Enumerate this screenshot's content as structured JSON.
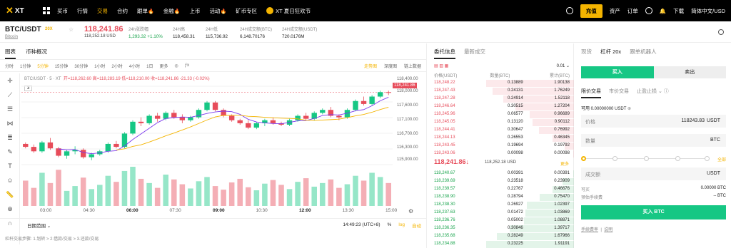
{
  "topbar": {
    "logo": "XT",
    "nav": [
      "买币",
      "行情",
      "交易",
      "合约",
      "跟单",
      "金融",
      "上币",
      "活动",
      "矿币专区"
    ],
    "active_nav": "交易",
    "banner": "XT 夏日狂欢节",
    "recharge": "充值",
    "assets": "资产",
    "orders": "订单",
    "download": "下载",
    "lang": "简体中文/USD"
  },
  "ticker": {
    "pair": "BTC/USDT",
    "leverage": "20X",
    "name": "Bitcoin",
    "price": "118,241.86",
    "price_usd": "118,252.18 USD",
    "stats": [
      {
        "label": "24h涨跌幅",
        "value": "1,293.32 +1.10%",
        "green": true
      },
      {
        "label": "24H高",
        "value": "118,458.31"
      },
      {
        "label": "24H低",
        "value": "115,736.92"
      },
      {
        "label": "24H成交额(BTC)",
        "value": "6,148.70176"
      },
      {
        "label": "24H成交额(USDT)",
        "value": "720.0176M"
      }
    ]
  },
  "chart_panel": {
    "tabs": [
      "图表",
      "币种概况"
    ],
    "intervals": [
      "分时",
      "1分钟",
      "5分钟",
      "15分钟",
      "30分钟",
      "1小时",
      "2小时",
      "4小时",
      "1日",
      "更多"
    ],
    "active_interval": "5分钟",
    "views": [
      "走势图",
      "深度图",
      "链上数据"
    ],
    "active_view": "走势图",
    "ohlc_label": "BTC/USDT · 5 · XT",
    "ohlc": "开=118,262.60 高=118,283.19 低=118,210.00 收=118,241.86 -21.33 (-0.02%)",
    "count": "3",
    "current_price_tag": "118,241.86",
    "date_range": "日期范围",
    "time": "14:49:23 (UTC+8)",
    "pct": "%",
    "log": "log",
    "auto": "自动",
    "foot": "杠杆交易步骤: 1.划转 > 2.借款/交易 > 3.还款/交易"
  },
  "chart_data": {
    "type": "candlestick",
    "x_ticks": [
      "03:00",
      "04:30",
      "06:00",
      "07:30",
      "09:00",
      "10:30",
      "12:00",
      "13:30",
      "15:00"
    ],
    "bold_ticks": [
      "06:00",
      "09:00",
      "12:00"
    ],
    "y_ticks": [
      "118,400.00",
      "118,000.00",
      "117,600.00",
      "117,100.00",
      "116,700.00",
      "116,300.00",
      "115,900.00"
    ],
    "ylim": [
      115800,
      118450
    ],
    "candles": [
      [
        116500,
        116550,
        116350,
        116400
      ],
      [
        116400,
        116480,
        116200,
        116250
      ],
      [
        116250,
        116600,
        116200,
        116550
      ],
      [
        116550,
        116700,
        116300,
        116350
      ],
      [
        116350,
        116400,
        116050,
        116100
      ],
      [
        116100,
        116300,
        116000,
        116250
      ],
      [
        116250,
        116420,
        116150,
        116300
      ],
      [
        116300,
        116350,
        116000,
        116050
      ],
      [
        116050,
        116200,
        115950,
        116150
      ],
      [
        116150,
        116300,
        116100,
        116250
      ],
      [
        116250,
        116550,
        116200,
        116500
      ],
      [
        116500,
        116600,
        116350,
        116400
      ],
      [
        116400,
        116900,
        116350,
        116850
      ],
      [
        116850,
        117300,
        116800,
        117250
      ],
      [
        117250,
        117400,
        117100,
        117200
      ],
      [
        117200,
        117500,
        117150,
        117450
      ],
      [
        117450,
        117550,
        117250,
        117350
      ],
      [
        117350,
        117600,
        117300,
        117550
      ],
      [
        117550,
        117650,
        117350,
        117400
      ],
      [
        117400,
        117500,
        117200,
        117300
      ],
      [
        117300,
        117450,
        117250,
        117400
      ],
      [
        117400,
        117700,
        117350,
        117650
      ],
      [
        117650,
        117950,
        117600,
        117900
      ],
      [
        117900,
        117950,
        117600,
        117650
      ],
      [
        117650,
        117700,
        117400,
        117450
      ],
      [
        117450,
        117500,
        117250,
        117300
      ],
      [
        117300,
        117350,
        117150,
        117200
      ],
      [
        117200,
        117300,
        117000,
        117050
      ],
      [
        117050,
        117250,
        117000,
        117200
      ],
      [
        117200,
        117350,
        117100,
        117300
      ],
      [
        117300,
        117400,
        117150,
        117200
      ],
      [
        117200,
        117250,
        117100,
        117150
      ],
      [
        117150,
        117350,
        117100,
        117300
      ],
      [
        117300,
        117500,
        117250,
        117450
      ],
      [
        117450,
        117550,
        117300,
        117350
      ],
      [
        117350,
        117600,
        117300,
        117550
      ],
      [
        117550,
        117700,
        117500,
        117650
      ],
      [
        117650,
        117750,
        117400,
        117450
      ],
      [
        117450,
        117500,
        117300,
        117400
      ],
      [
        117400,
        117700,
        117350,
        117650
      ],
      [
        117650,
        118000,
        117600,
        117950
      ],
      [
        117950,
        118100,
        117800,
        117850
      ],
      [
        117850,
        118150,
        117800,
        118100
      ],
      [
        118100,
        118300,
        118050,
        118250
      ],
      [
        118250,
        118300,
        118150,
        118242
      ]
    ],
    "volumes": [
      42,
      30,
      55,
      38,
      60,
      25,
      33,
      47,
      28,
      35,
      50,
      40,
      58,
      65,
      45,
      38,
      30,
      52,
      44,
      36,
      29,
      41,
      48,
      33,
      27,
      39,
      45,
      31,
      26,
      37,
      43,
      35,
      28,
      40,
      46,
      32,
      38,
      44,
      30,
      36,
      50,
      42,
      55,
      48,
      38
    ],
    "ma_lines": [
      {
        "color": "#7c3aed"
      },
      {
        "color": "#f4b400"
      }
    ]
  },
  "orderbook": {
    "tabs": [
      "委托信息",
      "最新成交"
    ],
    "precision": "0.01",
    "cols": [
      "价格(USDT)",
      "数量(BTC)",
      "累计(BTC)"
    ],
    "asks": [
      [
        "118,248.22",
        "0.13889",
        "1.90138",
        0.95
      ],
      [
        "118,247.43",
        "0.24131",
        "1.76249",
        0.88
      ],
      [
        "118,247.28",
        "0.24914",
        "1.52118",
        0.76
      ],
      [
        "118,246.64",
        "0.30515",
        "1.27204",
        0.63
      ],
      [
        "118,245.96",
        "0.06577",
        "0.96689",
        0.48
      ],
      [
        "118,245.05",
        "0.13120",
        "0.90112",
        0.45
      ],
      [
        "118,244.41",
        "0.30647",
        "0.76992",
        0.38
      ],
      [
        "118,244.13",
        "0.26553",
        "0.46345",
        0.23
      ],
      [
        "118,243.45",
        "0.19694",
        "0.19792",
        0.1
      ],
      [
        "118,243.06",
        "0.00098",
        "0.00098",
        0.01
      ]
    ],
    "mid_price": "118,241.86↓",
    "mid_usd": "118,252.18 USD",
    "more": "更多",
    "bids": [
      [
        "118,240.67",
        "0.00391",
        "0.00391",
        0.01
      ],
      [
        "118,239.69",
        "0.23518",
        "0.23909",
        0.12
      ],
      [
        "118,239.57",
        "0.22767",
        "0.46676",
        0.23
      ],
      [
        "118,238.90",
        "0.28794",
        "0.75470",
        0.37
      ],
      [
        "118,238.30",
        "0.26927",
        "1.02397",
        0.51
      ],
      [
        "118,237.63",
        "0.01472",
        "1.03869",
        0.52
      ],
      [
        "118,236.76",
        "0.05002",
        "1.08871",
        0.54
      ],
      [
        "118,236.35",
        "0.30846",
        "1.39717",
        0.69
      ],
      [
        "118,235.68",
        "0.28249",
        "1.67966",
        0.83
      ],
      [
        "118,234.88",
        "0.23225",
        "1.91191",
        0.95
      ]
    ]
  },
  "trade": {
    "tabs": [
      "现货",
      "杠杆 20x",
      "跟单机器人"
    ],
    "active_tab": "杠杆 20x",
    "buy": "买入",
    "sell": "卖出",
    "order_types": [
      "限价交易",
      "市价交易",
      "止盈止损"
    ],
    "available": "可用 0.00000000 USDT",
    "price_label": "价格",
    "price_value": "118243.83",
    "price_unit": "USDT",
    "qty_label": "数量",
    "qty_unit": "BTC",
    "all": "全部",
    "amount_label": "成交额",
    "amount_unit": "USDT",
    "can_buy_label": "可买",
    "can_buy_value": "0.00000 BTC",
    "fee_label": "预估手续费",
    "fee_value": "-- BTC",
    "buy_button": "买入 BTC",
    "links": [
      "手续费率",
      "说明"
    ]
  }
}
